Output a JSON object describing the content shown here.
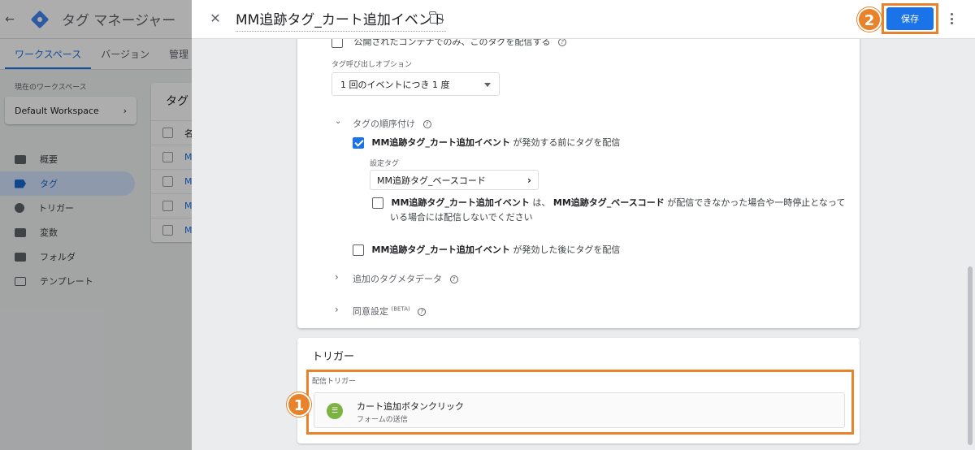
{
  "background_app": {
    "title": "タグ マネージャー",
    "tabs": [
      "ワークスペース",
      "バージョン",
      "管理"
    ],
    "workspace_label": "現在のワークスペース",
    "workspace_name": "Default Workspace",
    "nav": [
      "概要",
      "タグ",
      "トリガー",
      "変数",
      "フォルダ",
      "テンプレート"
    ],
    "tags_card_title": "タグ",
    "tags_header_initial": "名",
    "tag_row_initial": "M"
  },
  "editor": {
    "title": "MM追跡タグ_カート追加イベント",
    "save_label": "保存",
    "publish_option_label": "公開されたコンテナでのみ、このタグを配信する",
    "firing_option_label": "タグ呼び出しオプション",
    "firing_option_value": "1 回のイベントにつき 1 度",
    "sequencing_label": "タグの順序付け",
    "setup_tag_before": {
      "tag": "MM追跡タグ_カート追加イベント",
      "suffix": "が発効する前にタグを配信",
      "checked": true
    },
    "setup_tag_label": "設定タグ",
    "setup_tag_value": "MM追跡タグ_ベースコード",
    "dont_fire_line1_tag1": "MM追跡タグ_カート追加イベント",
    "dont_fire_line1_mid": "は、",
    "dont_fire_line1_tag2": "MM追跡タグ_ベースコード",
    "dont_fire_line1_suffix": "が配信できなかった場合や一時停止となって",
    "dont_fire_line2": "いる場合には配信しないでください",
    "cleanup_tag_after": {
      "tag": "MM追跡タグ_カート追加イベント",
      "suffix": "が発効した後にタグを配信",
      "checked": false
    },
    "additional_metadata_label": "追加のタグメタデータ",
    "consent_label": "同意設定",
    "consent_sup": "(BETA)",
    "trigger_section_title": "トリガー",
    "firing_triggers_label": "配信トリガー",
    "trigger_name": "カート追加ボタンクリック",
    "trigger_type": "フォームの送信"
  },
  "annotations": {
    "badge_1": "1",
    "badge_2": "2",
    "highlight_color": "#e8822b"
  },
  "colors": {
    "accent": "#1a73e8",
    "trigger_icon": "#7cb342"
  }
}
